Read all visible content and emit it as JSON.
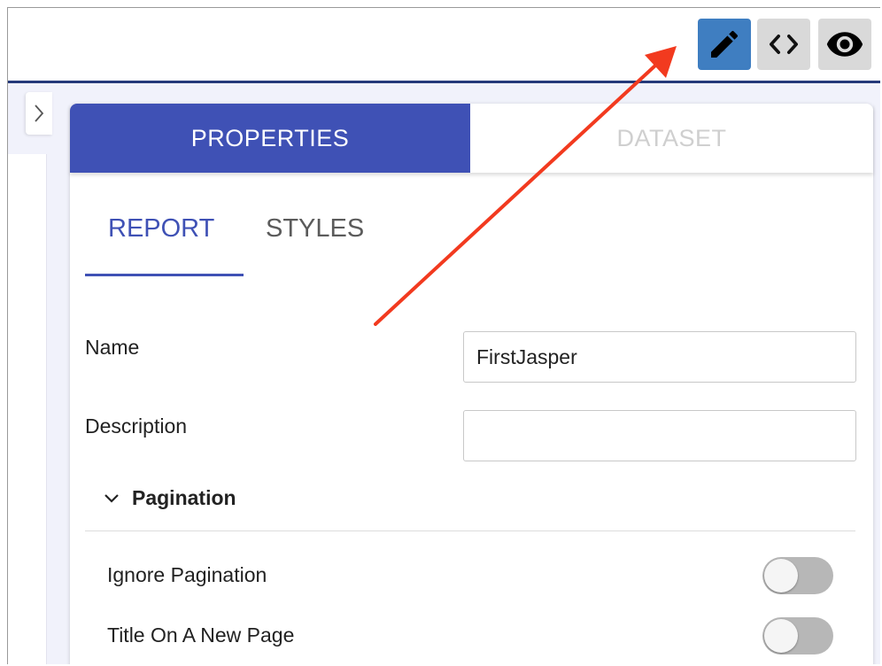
{
  "toolbar": {
    "buttons": [
      {
        "icon": "pencil-icon",
        "active": true
      },
      {
        "icon": "code-icon",
        "active": false
      },
      {
        "icon": "eye-icon",
        "active": false
      }
    ],
    "accent_color": "#3f7ec1"
  },
  "sidebar": {
    "collapse_icon": "chevron-right-icon"
  },
  "panel": {
    "tabs": [
      {
        "label": "PROPERTIES",
        "active": true
      },
      {
        "label": "DATASET",
        "active": false
      }
    ],
    "subtabs": [
      {
        "label": "REPORT",
        "active": true
      },
      {
        "label": "STYLES",
        "active": false
      }
    ],
    "fields": {
      "name": {
        "label": "Name",
        "value": "FirstJasper"
      },
      "description": {
        "label": "Description",
        "value": ""
      }
    },
    "pagination": {
      "title": "Pagination",
      "expanded": true,
      "toggles": [
        {
          "label": "Ignore Pagination",
          "on": false
        },
        {
          "label": "Title On A New Page",
          "on": false
        }
      ]
    },
    "accent_color": "#3f51b5"
  },
  "annotation": {
    "color": "#f23a1f"
  }
}
